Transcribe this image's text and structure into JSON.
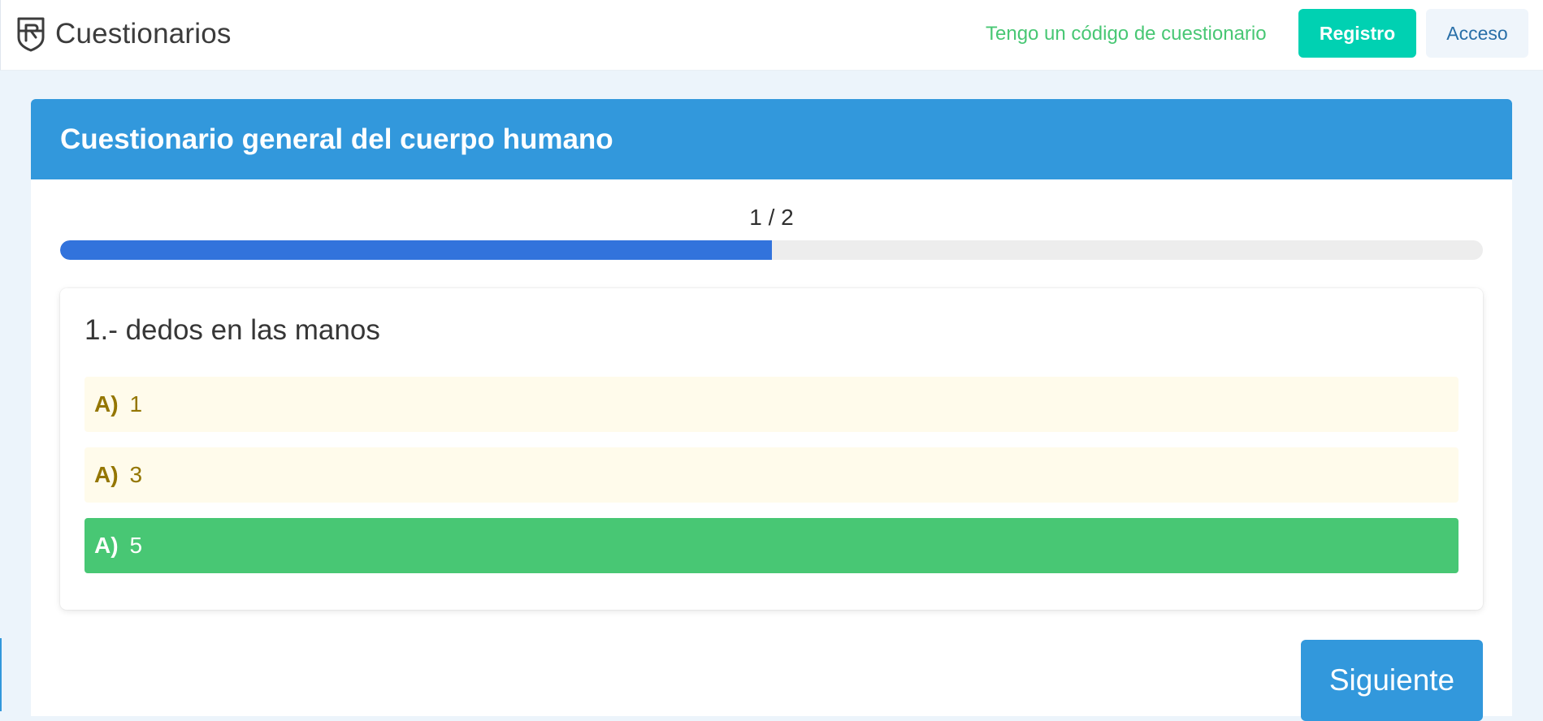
{
  "navbar": {
    "brand": "Cuestionarios",
    "brand_icon": "shield-icon",
    "code_link": "Tengo un código de cuestionario",
    "register_button": "Registro",
    "login_button": "Acceso"
  },
  "quiz": {
    "title": "Cuestionario general del cuerpo humano",
    "progress_label": "1 / 2",
    "progress": 0.5,
    "question": {
      "title": "1.- dedos en las manos",
      "options": [
        {
          "letter": "A)",
          "text": "1",
          "state": "neutral"
        },
        {
          "letter": "A)",
          "text": "3",
          "state": "neutral"
        },
        {
          "letter": "A)",
          "text": "5",
          "state": "correct"
        }
      ]
    },
    "next_button": "Siguiente"
  },
  "colors": {
    "primary": "#3298dc",
    "progress": "#3273dc",
    "success": "#48c774",
    "turquoise": "#00d1b2",
    "warning_light": "#fffbeb",
    "warning_text": "#947600"
  }
}
